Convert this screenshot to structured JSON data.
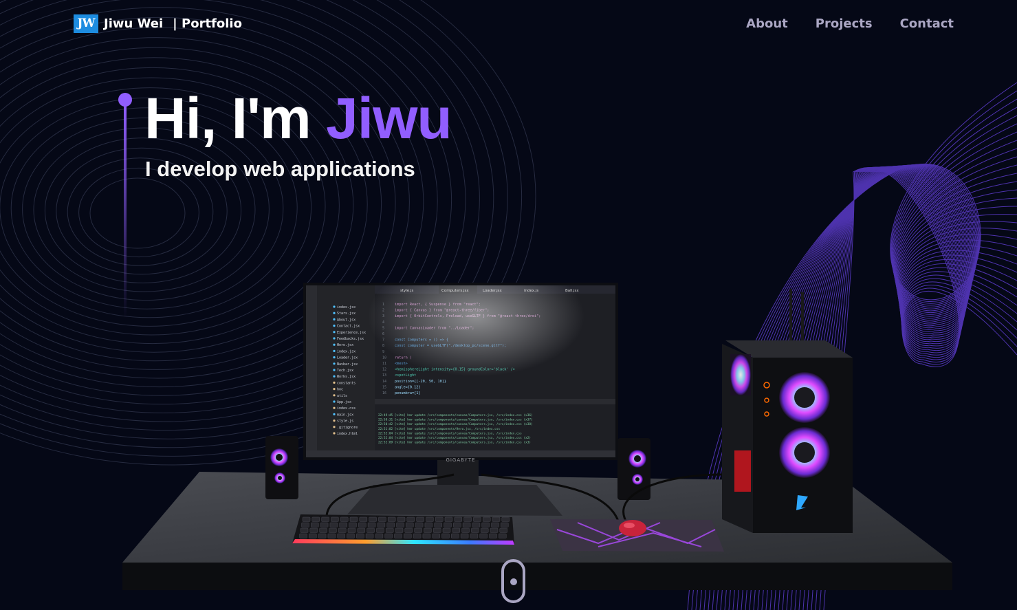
{
  "nav": {
    "logo_text": "JW",
    "brand_name": "Jiwu Wei",
    "brand_sub": "| Portfolio",
    "links": [
      {
        "label": "About"
      },
      {
        "label": "Projects"
      },
      {
        "label": "Contact"
      }
    ]
  },
  "hero": {
    "greeting": "Hi, I'm ",
    "name": "Jiwu",
    "subtitle": "I develop web applications"
  },
  "scene": {
    "monitor_brand": "GIGABYTE",
    "code_lines": [
      "import React, { Suspense } from \"react\";",
      "import { Canvas } from \"@react-three/fiber\";",
      "import { OrbitControls, Preload, useGLTF } from \"@react-three/drei\";",
      "",
      "import CanvasLoader from \"../Loader\";",
      "",
      "const Computers = () => {",
      "  const computer = useGLTF(\"./desktop_pc/scene.gltf\");",
      "",
      "  return (",
      "    <mesh>",
      "      <hemisphereLight intensity={0.15} groundColor='black' />",
      "      <spotLight",
      "        position={[-20, 50, 10]}",
      "        angle={0.12}",
      "        penumbra={1}"
    ],
    "terminal_lines": [
      "22:49:45 [vite] hmr update /src/components/canvas/Computers.jsx, /src/index.css (x36)",
      "22:50:31 [vite] hmr update /src/components/canvas/Computers.jsx, /src/index.css (x37)",
      "22:50:42 [vite] hmr update /src/components/canvas/Computers.jsx, /src/index.css (x38)",
      "22:51:02 [vite] hmr update /src/components/Hero.jsx, /src/index.css",
      "22:52:04 [vite] hmr update /src/components/canvas/Computers.jsx, /src/index.css",
      "22:52:04 [vite] hmr update /src/components/canvas/Computers.jsx, /src/index.css (x2)",
      "22:52:09 [vite] hmr update /src/components/canvas/Computers.jsx, /src/index.css (x3)"
    ],
    "explorer_files": [
      "index.jsx",
      "Stars.jsx",
      "About.jsx",
      "Contact.jsx",
      "Experience.jsx",
      "Feedbacks.jsx",
      "Hero.jsx",
      "index.jsx",
      "Loader.jsx",
      "Navbar.jsx",
      "Tech.jsx",
      "Works.jsx",
      "constants",
      "hoc",
      "utils",
      "App.jsx",
      "index.css",
      "main.jsx",
      "style.js",
      ".gitignore",
      "index.html"
    ],
    "tabs": [
      "style.js",
      "Computers.jsx",
      "Loader.jsx",
      "index.js",
      "Ball.jsx"
    ]
  },
  "colors": {
    "background": "#050816",
    "accent": "#915eff",
    "nav_text": "#aaa6c3",
    "logo_bg": "#1d8ce0"
  }
}
